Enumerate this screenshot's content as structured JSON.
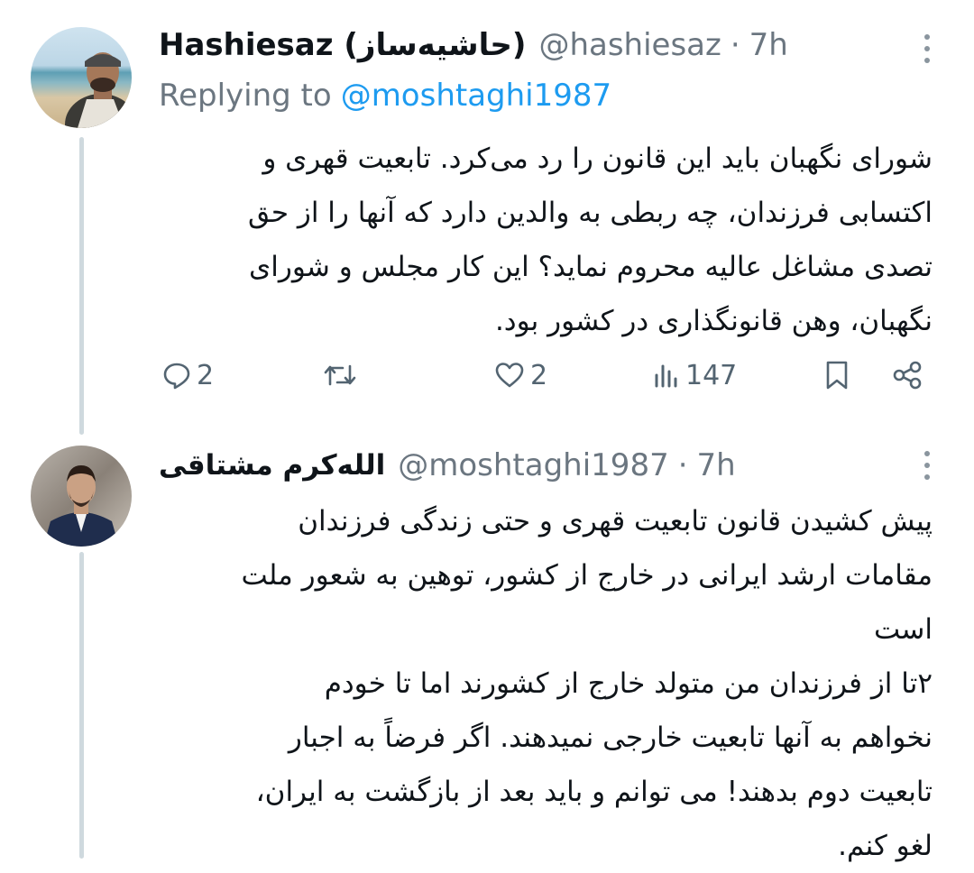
{
  "tweet1": {
    "name": "Hashiesaz (حاشیه‌ساز)",
    "handle": "@hashiesaz",
    "separator": "·",
    "time": "7h",
    "replying_prefix": "Replying to",
    "replying_handle": "@moshtaghi1987",
    "lines": [
      "شورای نگهبان باید این قانون را رد می‌کرد. تابعیت قهری و",
      "اکتسابی فرزندان، چه ربطی به والدین دارد که آنها را از حق",
      "تصدی مشاغل عالیه محروم نماید؟ این کار مجلس و شورای",
      "نگهبان، وهن قانونگذاری در کشور بود."
    ],
    "actions": {
      "replies": "2",
      "likes": "2",
      "views": "147"
    }
  },
  "tweet2": {
    "name": "الله‌کرم مشتاقی",
    "handle": "@moshtaghi1987",
    "separator": "·",
    "time": "7h",
    "lines": [
      "پیش کشیدن قانون تابعیت قهری و حتی زندگی فرزندان",
      "مقامات ارشد ایرانی در خارج از کشور، توهین به شعور ملت",
      "است",
      "۲تا از فرزندان من متولد خارج از کشورند اما تا خودم",
      "نخواهم به آنها تابعیت خارجی نمیدهند. اگر فرضاً به اجبار",
      "تابعیت دوم بدهند! می توانم و باید بعد از بازگشت به ایران،",
      "لغو کنم."
    ]
  },
  "icons": {
    "reply": "reply-icon",
    "retweet": "retweet-icon",
    "like": "heart-icon",
    "views": "views-icon",
    "bookmark": "bookmark-icon",
    "share": "share-icon",
    "more": "more-icon"
  },
  "colors": {
    "link": "#1d9bf0",
    "secondary_text": "#6b7680",
    "thread_line": "#cfd9de"
  }
}
